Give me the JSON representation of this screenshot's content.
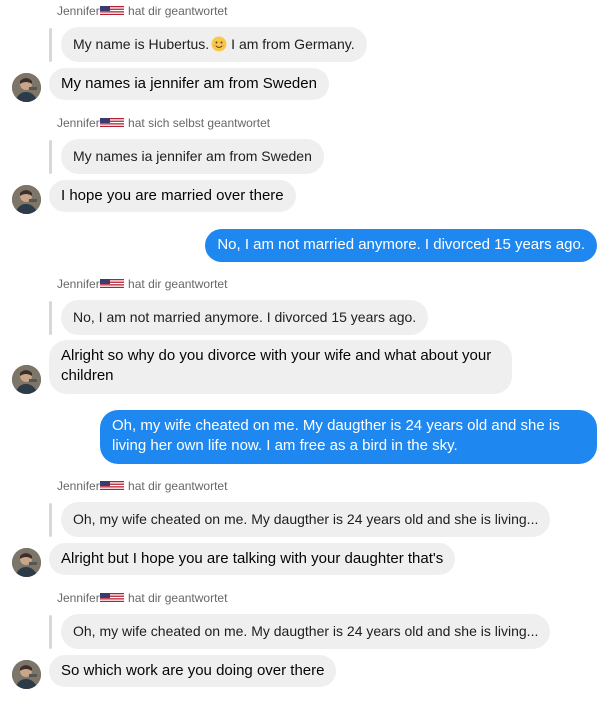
{
  "messages": [
    {
      "reply_sender": "Jennifer",
      "reply_note": "hat dir geantwortet",
      "quoted_before": "My name is Hubertus.",
      "quoted_after": "I am from Germany.",
      "quoted_emoji": "smiling-face-icon",
      "text": "My names ia jennifer am from Sweden"
    },
    {
      "reply_sender": "Jennifer",
      "reply_note": "hat sich selbst geantwortet",
      "quoted": "My names ia jennifer am from Sweden",
      "text": "I hope you are married over there"
    },
    {
      "outgoing": "No, I am not married anymore. I divorced 15 years ago."
    },
    {
      "reply_sender": "Jennifer",
      "reply_note": "hat dir geantwortet",
      "quoted": "No, I am not married anymore. I divorced 15 years ago.",
      "text": "Alright so why do you divorce with your wife and what about your children"
    },
    {
      "outgoing": "Oh, my wife cheated on me. My daugther is 24 years old and she is living her own life now. I am free as a bird in the sky."
    },
    {
      "reply_sender": "Jennifer",
      "reply_note": "hat dir geantwortet",
      "quoted": "Oh, my wife cheated on me. My daugther is 24 years old and she is living...",
      "text": "Alright but I hope you are talking with your daughter that's"
    },
    {
      "reply_sender": "Jennifer",
      "reply_note": "hat dir geantwortet",
      "quoted": "Oh, my wife cheated on me. My daugther is 24 years old and she is living...",
      "text": "So which work are you doing over there"
    }
  ],
  "colors": {
    "outgoing_bubble": "#1e88f0",
    "incoming_bubble": "#efefef",
    "meta_text": "#65676b"
  },
  "icons": {
    "flag": "us-flag-icon",
    "avatar": "contact-avatar"
  }
}
